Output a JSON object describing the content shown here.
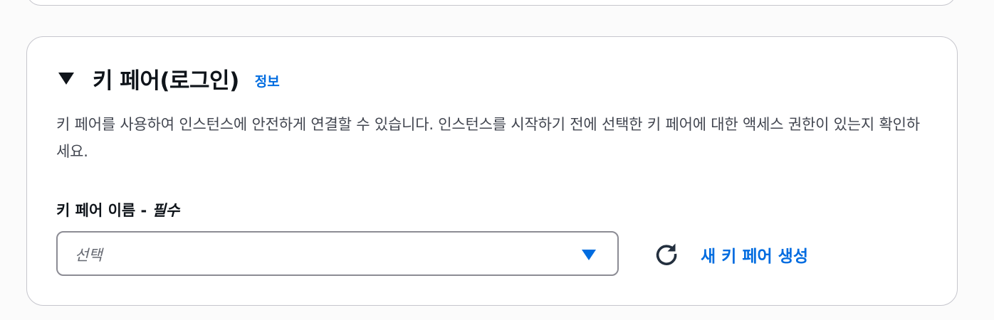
{
  "section": {
    "title": "키 페어(로그인)",
    "info_link": "정보",
    "description": "키 페어를 사용하여 인스턴스에 안전하게 연결할 수 있습니다. 인스턴스를 시작하기 전에 선택한 키 페어에 대한 액세스 권한이 있는지 확인하세요.",
    "field_label": "키 페어 이름 - ",
    "field_required": "필수",
    "select_placeholder": "선택",
    "create_link": "새 키 페어 생성",
    "icons": {
      "collapse": "caret-down-icon",
      "dropdown": "chevron-down-icon",
      "refresh": "refresh-icon"
    },
    "colors": {
      "link": "#006ce0",
      "text": "#0f141a",
      "secondary_text": "#424650",
      "border": "#8c8c94"
    }
  }
}
